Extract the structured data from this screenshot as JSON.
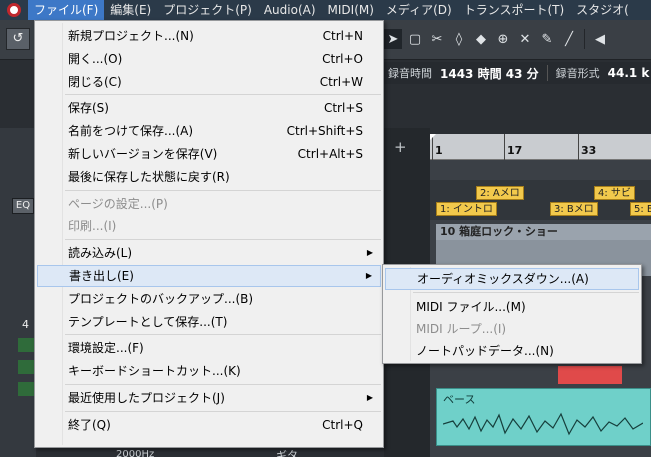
{
  "menubar": {
    "items": [
      {
        "label": "ファイル(F)",
        "active": true
      },
      {
        "label": "編集(E)"
      },
      {
        "label": "プロジェクト(P)"
      },
      {
        "label": "Audio(A)"
      },
      {
        "label": "MIDI(M)"
      },
      {
        "label": "メディア(D)"
      },
      {
        "label": "トランスポート(T)"
      },
      {
        "label": "スタジオ("
      }
    ]
  },
  "status": {
    "recording_time_label": "録音時間",
    "recording_time_value": "1443 時間 43 分",
    "record_format_label": "録音形式",
    "record_format_value": "44.1 k"
  },
  "ruler": {
    "bars": [
      "1",
      "17",
      "33"
    ]
  },
  "markers": [
    "2: Aメロ",
    "4: サビ",
    "1: イントロ",
    "3: Bメロ",
    "5: E"
  ],
  "parts": {
    "chord_track": "10 箱庭ロック・ショー",
    "bass": "ベース"
  },
  "inspector": {
    "eq_label": "EQ",
    "track_number": "4",
    "freq": "2000Hz",
    "track_name": "ギタ"
  },
  "file_menu": {
    "groups": [
      [
        {
          "label": "新規プロジェクト...(N)",
          "shortcut": "Ctrl+N"
        },
        {
          "label": "開く...(O)",
          "shortcut": "Ctrl+O"
        },
        {
          "label": "閉じる(C)",
          "shortcut": "Ctrl+W"
        }
      ],
      [
        {
          "label": "保存(S)",
          "shortcut": "Ctrl+S"
        },
        {
          "label": "名前をつけて保存...(A)",
          "shortcut": "Ctrl+Shift+S"
        },
        {
          "label": "新しいバージョンを保存(V)",
          "shortcut": "Ctrl+Alt+S"
        },
        {
          "label": "最後に保存した状態に戻す(R)",
          "shortcut": ""
        }
      ],
      [
        {
          "label": "ページの設定...(P)",
          "shortcut": "",
          "disabled": true
        },
        {
          "label": "印刷...(I)",
          "shortcut": "",
          "disabled": true
        }
      ],
      [
        {
          "label": "読み込み(L)",
          "submenu": true
        },
        {
          "label": "書き出し(E)",
          "submenu": true,
          "hover": true
        },
        {
          "label": "プロジェクトのバックアップ...(B)"
        },
        {
          "label": "テンプレートとして保存...(T)"
        }
      ],
      [
        {
          "label": "環境設定...(F)"
        },
        {
          "label": "キーボードショートカット...(K)"
        }
      ],
      [
        {
          "label": "最近使用したプロジェクト(J)",
          "submenu": true
        }
      ],
      [
        {
          "label": "終了(Q)",
          "shortcut": "Ctrl+Q"
        }
      ]
    ]
  },
  "export_menu": {
    "items": [
      {
        "label": "オーディオミックスダウン...(A)",
        "hover": true
      },
      {
        "separator": true
      },
      {
        "label": "MIDI ファイル...(M)"
      },
      {
        "label": "MIDI ループ...(I)",
        "disabled": true
      },
      {
        "label": "ノートパッドデータ...(N)"
      }
    ]
  },
  "colors": {
    "menubar_bg": "#2b3a49",
    "menu_active": "#3d78c7",
    "marker": "#f2c94c",
    "bass_part": "#6fd0c9",
    "red_part": "#e04a4a"
  },
  "icons": [
    "undo-icon",
    "pointer-tool-icon",
    "range-tool-icon",
    "split-tool-icon",
    "glue-tool-icon",
    "erase-tool-icon",
    "zoom-tool-icon",
    "mute-tool-icon",
    "draw-tool-icon",
    "line-tool-icon",
    "speaker-icon"
  ]
}
